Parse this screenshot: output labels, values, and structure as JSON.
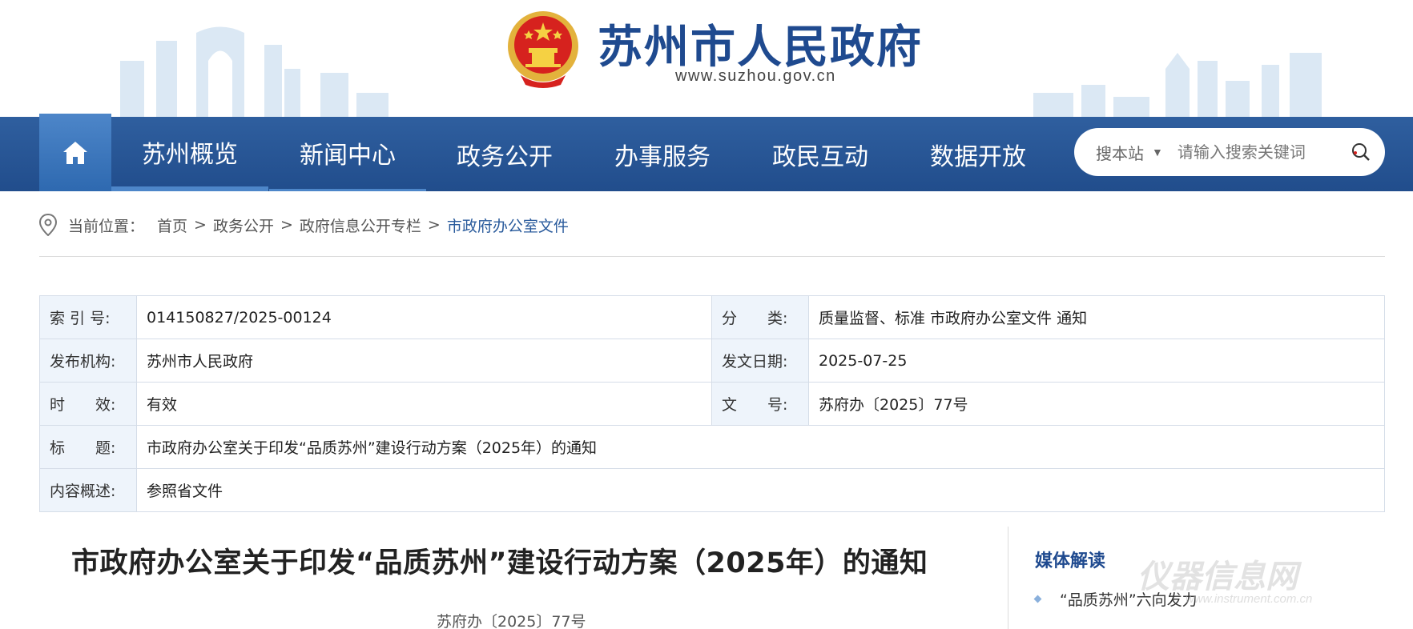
{
  "header": {
    "site_title": "苏州市人民政府",
    "site_url": "www.suzhou.gov.cn"
  },
  "nav": {
    "items": [
      {
        "label": "苏州概览"
      },
      {
        "label": "新闻中心"
      },
      {
        "label": "政务公开"
      },
      {
        "label": "办事服务"
      },
      {
        "label": "政民互动"
      },
      {
        "label": "数据开放"
      }
    ],
    "search_scope": "搜本站",
    "search_placeholder": "请输入搜索关键词"
  },
  "breadcrumb": {
    "prefix": "当前位置：",
    "items": [
      "首页",
      "政务公开",
      "政府信息公开专栏",
      "市政府办公室文件"
    ]
  },
  "info": {
    "index_label": "索 引 号:",
    "index_value": "014150827/2025-00124",
    "category_label": "分　　类:",
    "category_value": "质量监督、标准 市政府办公室文件 通知",
    "publisher_label": "发布机构:",
    "publisher_value": "苏州市人民政府",
    "date_label": "发文日期:",
    "date_value": "2025-07-25",
    "validity_label": "时　　效:",
    "validity_value": "有效",
    "docno_label": "文　　号:",
    "docno_value": "苏府办〔2025〕77号",
    "title_label": "标　　题:",
    "title_value": "市政府办公室关于印发“品质苏州”建设行动方案（2025年）的通知",
    "summary_label": "内容概述:",
    "summary_value": "参照省文件"
  },
  "article": {
    "title": "市政府办公室关于印发“品质苏州”建设行动方案（2025年）的通知",
    "doc_number": "苏府办〔2025〕77号"
  },
  "sidebar": {
    "title": "媒体解读",
    "items": [
      {
        "label": "“品质苏州”六向发力"
      }
    ]
  },
  "watermark": {
    "text": "仪器信息网",
    "sub": "www.instrument.com.cn"
  },
  "colors": {
    "brand_blue": "#1f4a8f",
    "nav_bg": "#2a5795",
    "home_bg": "#3b78bd",
    "label_bg": "#eef4fb"
  }
}
